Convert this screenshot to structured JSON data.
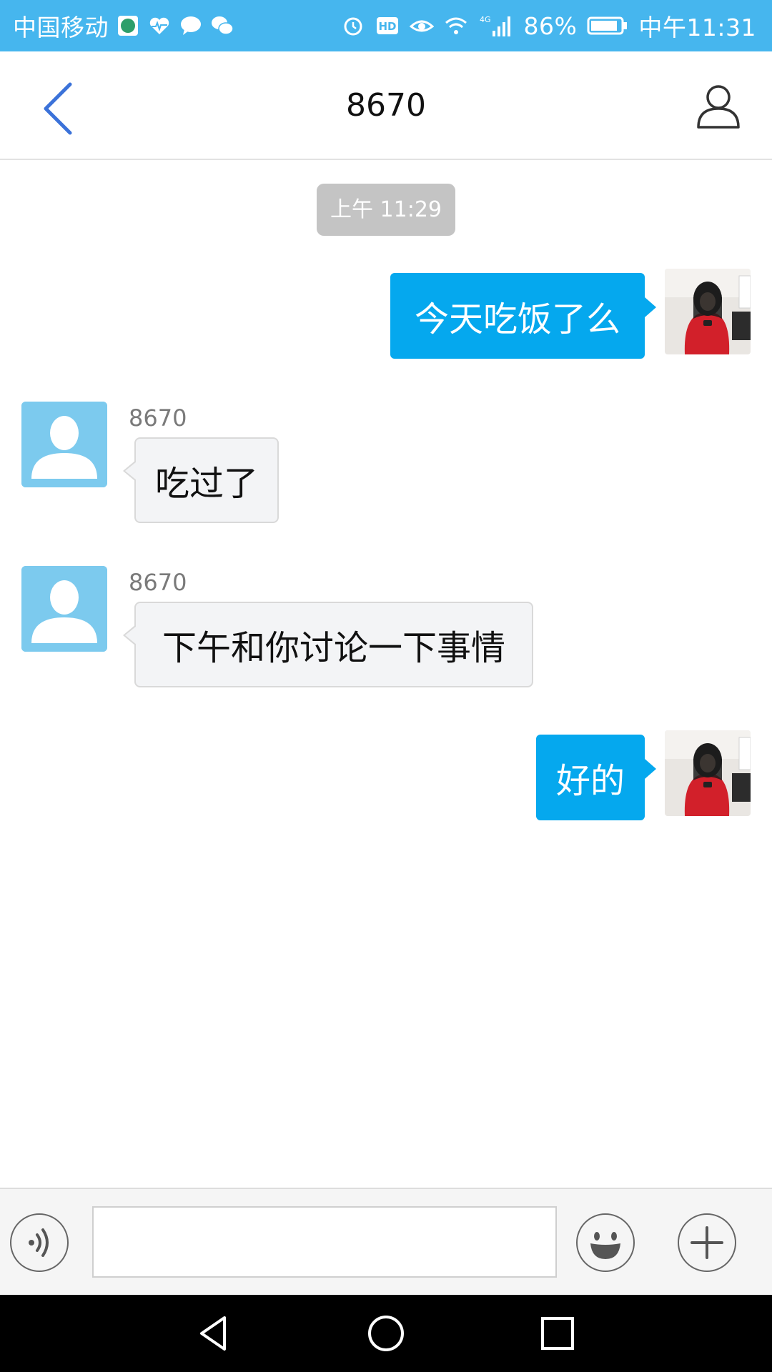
{
  "status_bar": {
    "carrier": "中国移动",
    "battery": "86%",
    "network": "4G",
    "time": "中午11:31",
    "icons": [
      "app-icon",
      "health-icon",
      "message-icon",
      "wechat-icon",
      "alarm-icon",
      "hd-icon",
      "eye-icon",
      "wifi-icon",
      "signal-icon",
      "battery-icon"
    ],
    "bg_color": "#46b6ee"
  },
  "header": {
    "title": "8670",
    "back_icon": "chevron-left-icon",
    "contact_icon": "person-outline-icon"
  },
  "conversation": {
    "timestamp": "上午 11:29",
    "messages": [
      {
        "direction": "outgoing",
        "text": "今天吃饭了么"
      },
      {
        "direction": "incoming",
        "sender": "8670",
        "text": "吃过了"
      },
      {
        "direction": "incoming",
        "sender": "8670",
        "text": "下午和你讨论一下事情"
      },
      {
        "direction": "outgoing",
        "text": "好的"
      }
    ],
    "outgoing_bubble_color": "#05a8ee",
    "incoming_bubble_color": "#f3f4f6"
  },
  "input_bar": {
    "voice_icon": "voice-icon",
    "message_value": "",
    "emoji_icon": "smiley-icon",
    "plus_icon": "plus-icon"
  },
  "nav_bar": {
    "icons": [
      "back-triangle-icon",
      "home-circle-icon",
      "recents-square-icon"
    ]
  }
}
